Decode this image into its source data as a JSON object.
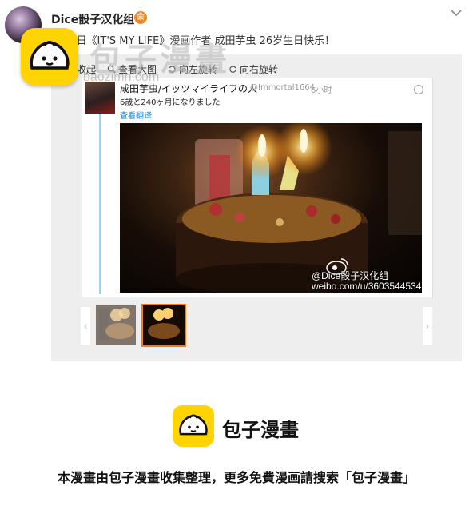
{
  "header": {
    "username": "Dice骰子汉化组",
    "vip_badge": "会",
    "post_text": "月27日《IT'S MY LIFE》漫画作者 成田芋虫 26岁生日快乐！"
  },
  "watermark": {
    "text": "包子漫畫",
    "url": "baozimh.com"
  },
  "toolbar": {
    "collapse_label": "收起",
    "view_large_label": "查看大图",
    "rotate_left_label": "向左旋转",
    "rotate_right_label": "向右旋转"
  },
  "tweet": {
    "name": "成田芋虫/イッツマイライフの人",
    "handle": "@Immortal1664",
    "time": "6小时",
    "body": "6歳と240ヶ月になりました",
    "translate_label": "查看翻译"
  },
  "photo": {
    "weibo_mark": "@Dice骰子汉化组",
    "weibo_url": "weibo.com/u/3603544534"
  },
  "thumbnails": {
    "prev_icon": "‹",
    "next_icon": "›",
    "selected_index": 1
  },
  "promo": {
    "name": "包子漫畫",
    "line": "本漫畫由包子漫畫收集整理，更多免費漫画請搜索「包子漫畫」"
  },
  "colors": {
    "logo_yellow": "#ffd400",
    "link_blue": "#1a7ec9",
    "thumb_selected": "#f07a1e"
  }
}
